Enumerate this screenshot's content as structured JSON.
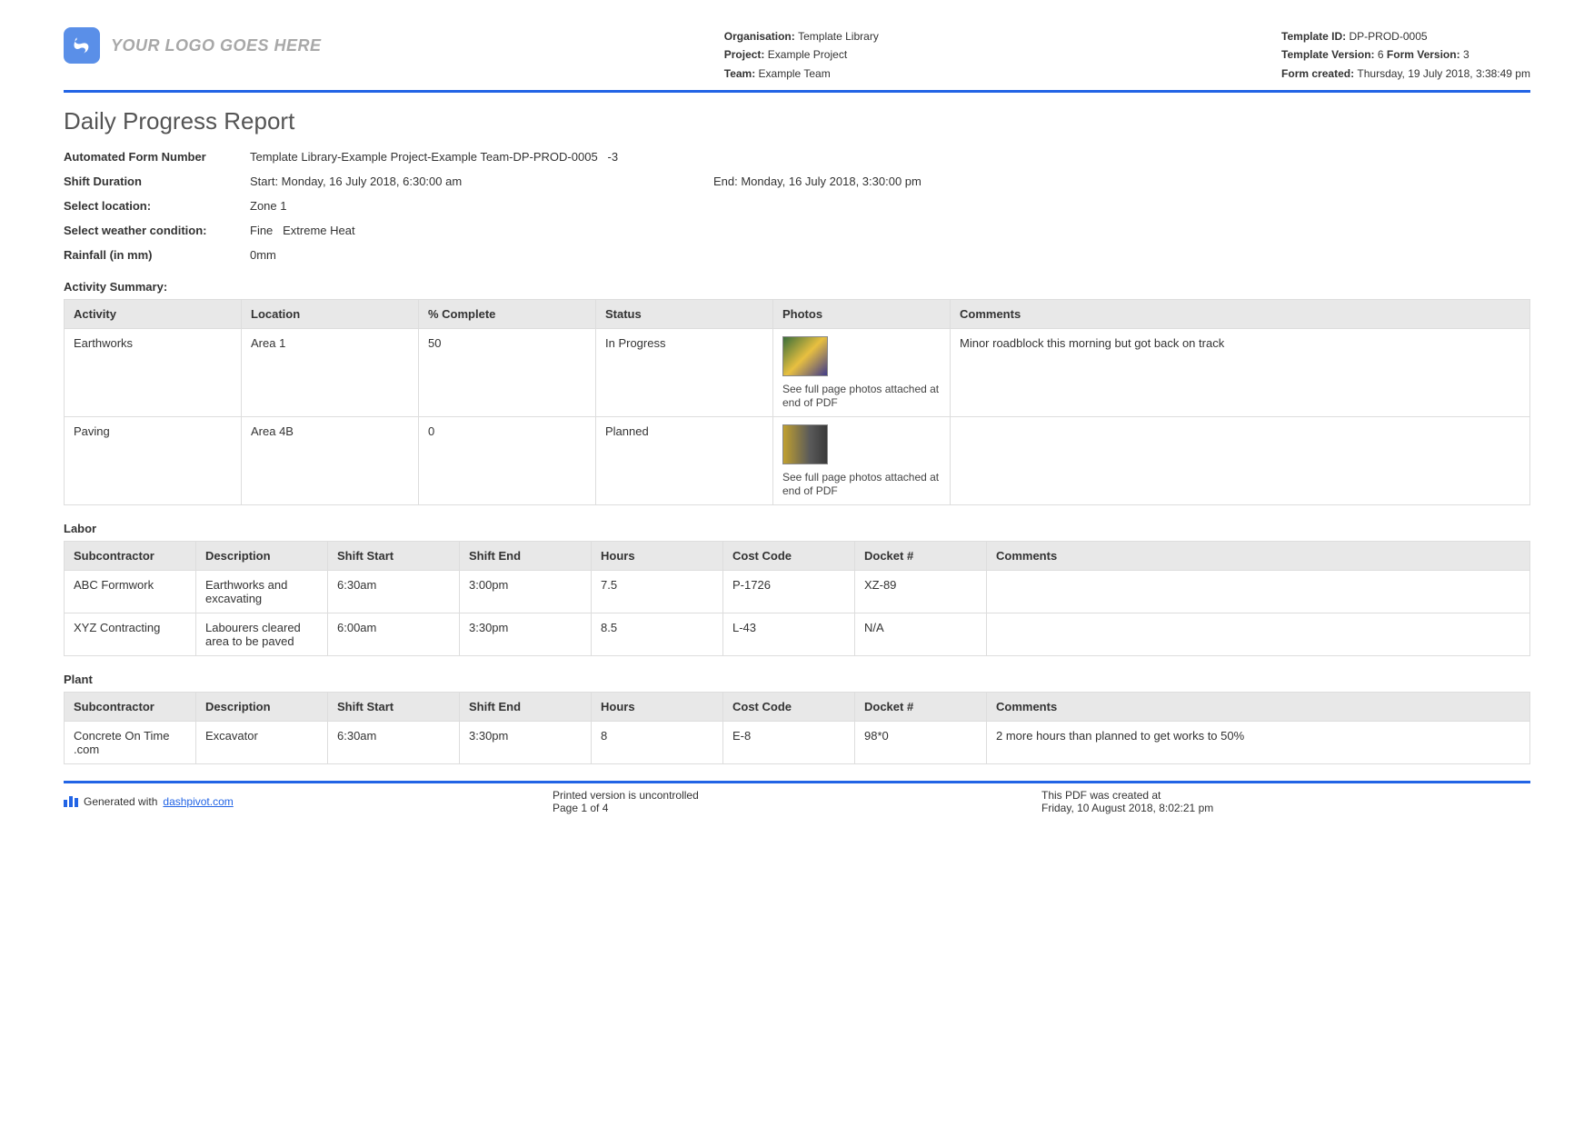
{
  "header": {
    "logo_text": "YOUR LOGO GOES HERE",
    "org_label": "Organisation:",
    "org_value": "Template Library",
    "project_label": "Project:",
    "project_value": "Example Project",
    "team_label": "Team:",
    "team_value": "Example Team",
    "template_id_label": "Template ID:",
    "template_id_value": "DP-PROD-0005",
    "template_version_label": "Template Version:",
    "template_version_value": "6",
    "form_version_label": "Form Version:",
    "form_version_value": "3",
    "form_created_label": "Form created:",
    "form_created_value": "Thursday, 19 July 2018, 3:38:49 pm"
  },
  "title": "Daily Progress Report",
  "fields": {
    "form_number_label": "Automated Form Number",
    "form_number_value": "Template Library-Example Project-Example Team-DP-PROD-0005   -3",
    "shift_label": "Shift Duration",
    "shift_start": "Start: Monday, 16 July 2018, 6:30:00 am",
    "shift_end": "End: Monday, 16 July 2018, 3:30:00 pm",
    "location_label": "Select location:",
    "location_value": "Zone 1",
    "weather_label": "Select weather condition:",
    "weather_value": "Fine   Extreme Heat",
    "rainfall_label": "Rainfall (in mm)",
    "rainfall_value": "0mm"
  },
  "activity": {
    "section_label": "Activity Summary:",
    "headers": [
      "Activity",
      "Location",
      "% Complete",
      "Status",
      "Photos",
      "Comments"
    ],
    "photo_note": "See full page photos attached at end of PDF",
    "rows": [
      {
        "activity": "Earthworks",
        "location": "Area 1",
        "complete": "50",
        "status": "In Progress",
        "comments": "Minor roadblock this morning but got back on track"
      },
      {
        "activity": "Paving",
        "location": "Area 4B",
        "complete": "0",
        "status": "Planned",
        "comments": ""
      }
    ]
  },
  "labor": {
    "section_label": "Labor",
    "headers": [
      "Subcontractor",
      "Description",
      "Shift Start",
      "Shift End",
      "Hours",
      "Cost Code",
      "Docket #",
      "Comments"
    ],
    "rows": [
      {
        "sub": "ABC Formwork",
        "desc": "Earthworks and excavating",
        "start": "6:30am",
        "end": "3:00pm",
        "hours": "7.5",
        "cost": "P-1726",
        "docket": "XZ-89",
        "comments": ""
      },
      {
        "sub": "XYZ Contracting",
        "desc": "Labourers cleared area to be paved",
        "start": "6:00am",
        "end": "3:30pm",
        "hours": "8.5",
        "cost": "L-43",
        "docket": "N/A",
        "comments": ""
      }
    ]
  },
  "plant": {
    "section_label": "Plant",
    "headers": [
      "Subcontractor",
      "Description",
      "Shift Start",
      "Shift End",
      "Hours",
      "Cost Code",
      "Docket #",
      "Comments"
    ],
    "rows": [
      {
        "sub": "Concrete On Time .com",
        "desc": "Excavator",
        "start": "6:30am",
        "end": "3:30pm",
        "hours": "8",
        "cost": "E-8",
        "docket": "98*0",
        "comments": "2 more hours than planned to get works to 50%"
      }
    ]
  },
  "footer": {
    "generated_prefix": "Generated with ",
    "generated_link": "dashpivot.com",
    "uncontrolled": "Printed version is uncontrolled",
    "page": "Page 1 of 4",
    "created_label": "This PDF was created at",
    "created_value": "Friday, 10 August 2018, 8:02:21 pm"
  }
}
